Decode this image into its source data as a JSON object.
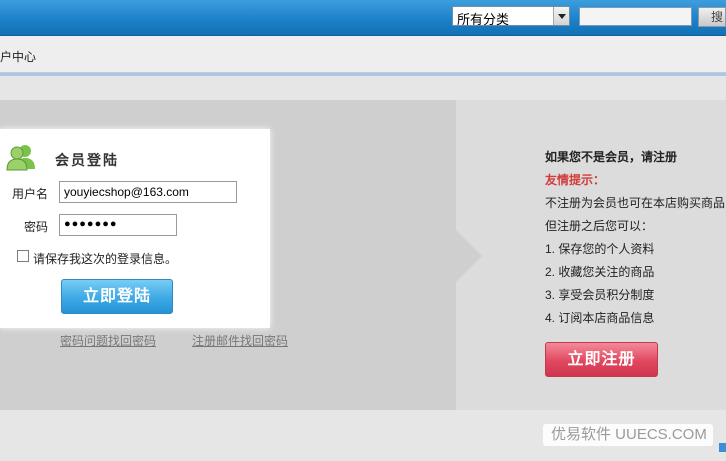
{
  "header": {
    "category_select": "所有分类",
    "search_value": "",
    "search_button": "搜"
  },
  "breadcrumb": "户中心",
  "login": {
    "title": "会员登陆",
    "username_label": "用户名",
    "username_value": "youyiecshop@163.com",
    "password_label": "密码",
    "password_value": "●●●●●●●",
    "remember_label": "请保存我这次的登录信息。",
    "remember_checked": false,
    "submit_label": "立即登陆",
    "link_password_question": "密码问题找回密码",
    "link_email_reset": "注册邮件找回密码"
  },
  "register": {
    "title": "如果您不是会员，请注册",
    "tip_heading": "友情提示：",
    "line1": "不注册为会员也可在本店购买商品",
    "line2": "但注册之后您可以：",
    "benefits": [
      "1.  保存您的个人资料",
      "2.  收藏您关注的商品",
      "3.  享受会员积分制度",
      "4.  订阅本店商品信息"
    ],
    "submit_label": "立即注册"
  },
  "watermark": "优易软件 UUECS.COM",
  "colors": {
    "header_blue": "#1b7fc7",
    "login_button": "#3da9e5",
    "register_button": "#e0485f",
    "tip_red": "#d23b3b"
  }
}
